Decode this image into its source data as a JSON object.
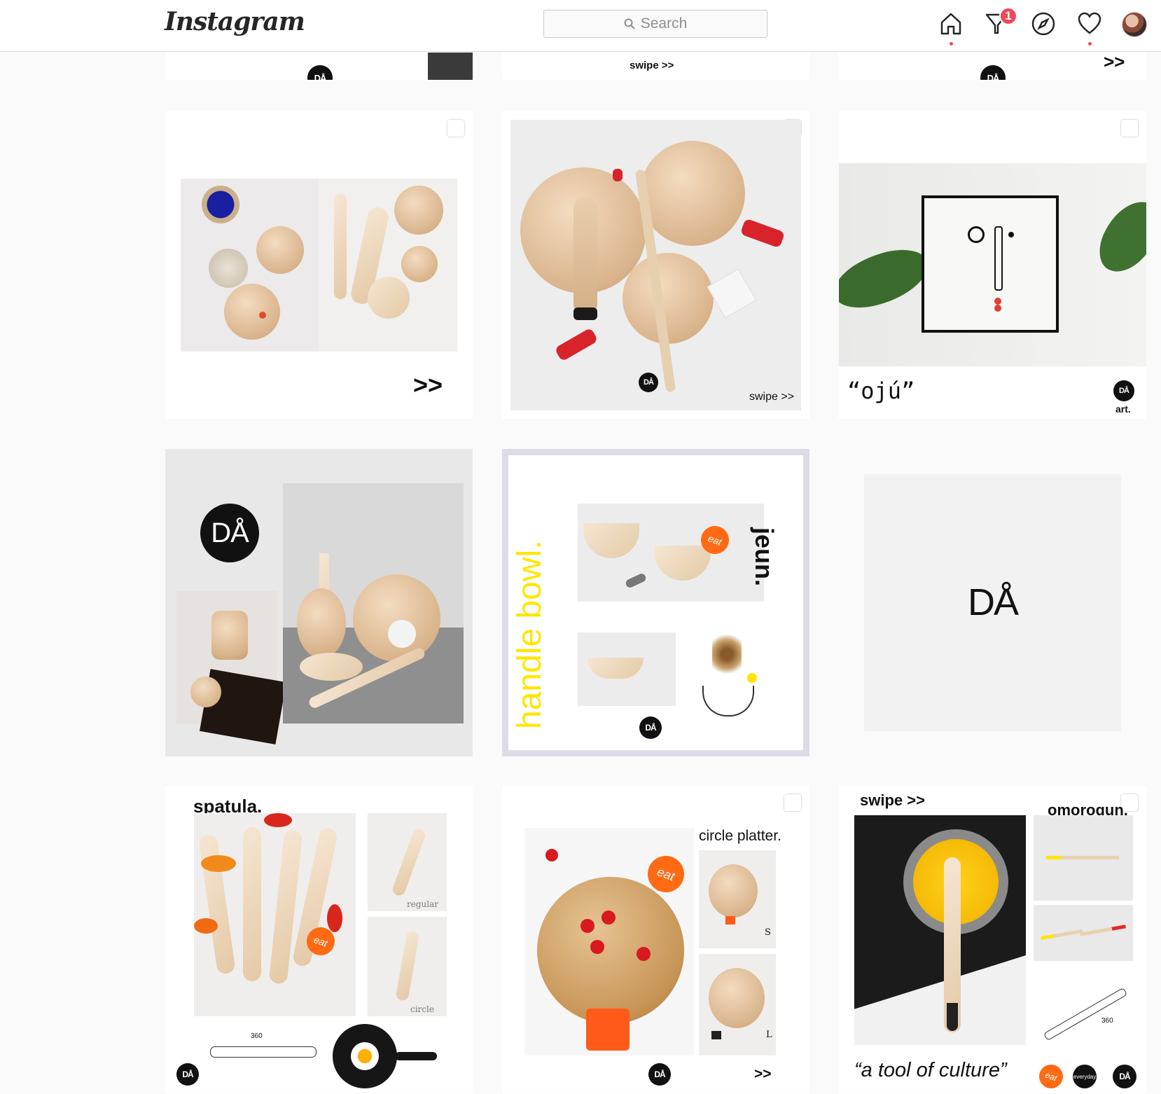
{
  "header": {
    "logo_text": "Instagram",
    "search_placeholder": "Search",
    "notification_count": "1",
    "nav_icons": [
      "home-icon",
      "direct-icon",
      "explore-icon",
      "activity-icon",
      "profile-avatar"
    ]
  },
  "row0": {
    "tile2_text": "swipe >>",
    "tile3_text": ">>"
  },
  "posts": {
    "p1": {
      "arrow": ">>"
    },
    "p2": {
      "swipe": "swipe >>",
      "logo": "DÅ"
    },
    "p3": {
      "title": "“ojú”",
      "logo": "DÅ",
      "logo_caption": "art."
    },
    "p4": {
      "logo": "DÅ"
    },
    "p5": {
      "vertical_title": "handle bowl.",
      "side_title": "jeun.",
      "eat": "eat",
      "logo": "DÅ"
    },
    "p6": {
      "logo": "DÅ"
    },
    "p7": {
      "title": "spatula.",
      "label_regular": "regular",
      "label_circle": "circle",
      "eat": "eat",
      "size": "360",
      "logo": "DÅ"
    },
    "p8": {
      "title": "circle platter.",
      "label_s": "S",
      "label_l": "L",
      "eat": "eat",
      "arrow": ">>",
      "logo": "DÅ"
    },
    "p9": {
      "swipe": "swipe >>",
      "title": "omorogun.",
      "quote": "“a tool of culture”",
      "eat": "eat",
      "everyday": "everyday",
      "size": "360",
      "logo": "DÅ"
    }
  },
  "colors": {
    "accent_orange": "#ff6a13",
    "accent_yellow": "#fff200",
    "badge_red": "#ed4956"
  }
}
